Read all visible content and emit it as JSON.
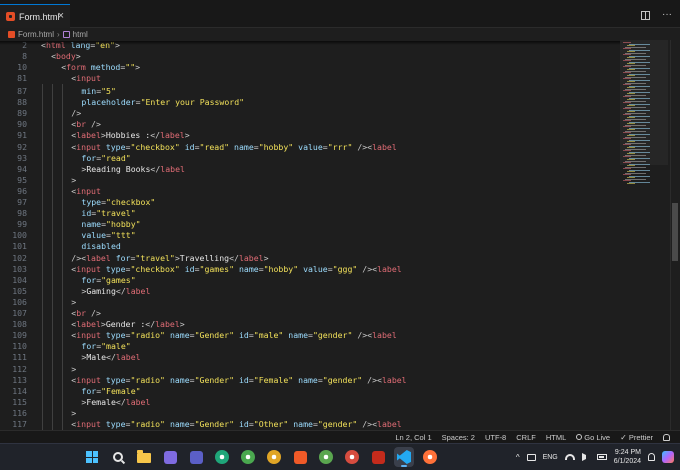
{
  "tab": {
    "label": "Form.html",
    "close": "×"
  },
  "breadcrumb": {
    "file": "Form.html",
    "separator": "›",
    "element": "html"
  },
  "editor": {
    "sticky_lines": [
      {
        "num": "2",
        "indent": 0,
        "tokens": [
          [
            "punc",
            "<"
          ],
          [
            "tag",
            "html"
          ],
          [
            "text",
            " "
          ],
          [
            "attr",
            "lang"
          ],
          [
            "eq",
            "="
          ],
          [
            "str",
            "\"en\""
          ],
          [
            "punc",
            ">"
          ]
        ]
      },
      {
        "num": "8",
        "indent": 1,
        "tokens": [
          [
            "punc",
            "<"
          ],
          [
            "tag",
            "body"
          ],
          [
            "punc",
            ">"
          ]
        ]
      },
      {
        "num": "10",
        "indent": 2,
        "tokens": [
          [
            "punc",
            "<"
          ],
          [
            "tag",
            "form"
          ],
          [
            "text",
            " "
          ],
          [
            "attr",
            "method"
          ],
          [
            "eq",
            "="
          ],
          [
            "str",
            "\"\""
          ],
          [
            "punc",
            ">"
          ]
        ]
      },
      {
        "num": "81",
        "indent": 3,
        "tokens": [
          [
            "punc",
            "<"
          ],
          [
            "tag",
            "input"
          ]
        ]
      }
    ],
    "lines": [
      {
        "num": "87",
        "indent": 4,
        "tokens": [
          [
            "attr",
            "min"
          ],
          [
            "eq",
            "="
          ],
          [
            "str",
            "\"5\""
          ]
        ]
      },
      {
        "num": "88",
        "indent": 4,
        "tokens": [
          [
            "attr",
            "placeholder"
          ],
          [
            "eq",
            "="
          ],
          [
            "str",
            "\"Enter your Password\""
          ]
        ]
      },
      {
        "num": "89",
        "indent": 3,
        "tokens": [
          [
            "punc",
            "/>"
          ]
        ]
      },
      {
        "num": "90",
        "indent": 3,
        "tokens": [
          [
            "punc",
            "<"
          ],
          [
            "tag",
            "br"
          ],
          [
            "text",
            " "
          ],
          [
            "punc",
            "/>"
          ]
        ]
      },
      {
        "num": "91",
        "indent": 3,
        "tokens": [
          [
            "punc",
            "<"
          ],
          [
            "tag",
            "label"
          ],
          [
            "punc",
            ">"
          ],
          [
            "text",
            "Hobbies :"
          ],
          [
            "punc",
            "</"
          ],
          [
            "tag",
            "label"
          ],
          [
            "punc",
            ">"
          ]
        ]
      },
      {
        "num": "92",
        "indent": 3,
        "tokens": [
          [
            "punc",
            "<"
          ],
          [
            "tag",
            "input"
          ],
          [
            "text",
            " "
          ],
          [
            "attr",
            "type"
          ],
          [
            "eq",
            "="
          ],
          [
            "str",
            "\"checkbox\""
          ],
          [
            "text",
            " "
          ],
          [
            "attr",
            "id"
          ],
          [
            "eq",
            "="
          ],
          [
            "str",
            "\"read\""
          ],
          [
            "text",
            " "
          ],
          [
            "attr",
            "name"
          ],
          [
            "eq",
            "="
          ],
          [
            "str",
            "\"hobby\""
          ],
          [
            "text",
            " "
          ],
          [
            "attr",
            "value"
          ],
          [
            "eq",
            "="
          ],
          [
            "str",
            "\"rrr\""
          ],
          [
            "text",
            " "
          ],
          [
            "punc",
            "/><"
          ],
          [
            "tag",
            "label"
          ]
        ]
      },
      {
        "num": "93",
        "indent": 4,
        "tokens": [
          [
            "attr",
            "for"
          ],
          [
            "eq",
            "="
          ],
          [
            "str",
            "\"read\""
          ]
        ]
      },
      {
        "num": "94",
        "indent": 4,
        "tokens": [
          [
            "punc",
            ">"
          ],
          [
            "text",
            "Reading Books"
          ],
          [
            "punc",
            "</"
          ],
          [
            "tag",
            "label"
          ]
        ]
      },
      {
        "num": "95",
        "indent": 3,
        "tokens": [
          [
            "punc",
            ">"
          ]
        ]
      },
      {
        "num": "96",
        "indent": 3,
        "tokens": [
          [
            "punc",
            "<"
          ],
          [
            "tag",
            "input"
          ]
        ]
      },
      {
        "num": "97",
        "indent": 4,
        "tokens": [
          [
            "attr",
            "type"
          ],
          [
            "eq",
            "="
          ],
          [
            "str",
            "\"checkbox\""
          ]
        ]
      },
      {
        "num": "98",
        "indent": 4,
        "tokens": [
          [
            "attr",
            "id"
          ],
          [
            "eq",
            "="
          ],
          [
            "str",
            "\"travel\""
          ]
        ]
      },
      {
        "num": "99",
        "indent": 4,
        "tokens": [
          [
            "attr",
            "name"
          ],
          [
            "eq",
            "="
          ],
          [
            "str",
            "\"hobby\""
          ]
        ]
      },
      {
        "num": "100",
        "indent": 4,
        "tokens": [
          [
            "attr",
            "value"
          ],
          [
            "eq",
            "="
          ],
          [
            "str",
            "\"ttt\""
          ]
        ]
      },
      {
        "num": "101",
        "indent": 4,
        "tokens": [
          [
            "attr",
            "disabled"
          ]
        ]
      },
      {
        "num": "102",
        "indent": 3,
        "tokens": [
          [
            "punc",
            "/><"
          ],
          [
            "tag",
            "label"
          ],
          [
            "text",
            " "
          ],
          [
            "attr",
            "for"
          ],
          [
            "eq",
            "="
          ],
          [
            "str",
            "\"travel\""
          ],
          [
            "punc",
            ">"
          ],
          [
            "text",
            "Travelling"
          ],
          [
            "punc",
            "</"
          ],
          [
            "tag",
            "label"
          ],
          [
            "punc",
            ">"
          ]
        ]
      },
      {
        "num": "103",
        "indent": 3,
        "tokens": [
          [
            "punc",
            "<"
          ],
          [
            "tag",
            "input"
          ],
          [
            "text",
            " "
          ],
          [
            "attr",
            "type"
          ],
          [
            "eq",
            "="
          ],
          [
            "str",
            "\"checkbox\""
          ],
          [
            "text",
            " "
          ],
          [
            "attr",
            "id"
          ],
          [
            "eq",
            "="
          ],
          [
            "str",
            "\"games\""
          ],
          [
            "text",
            " "
          ],
          [
            "attr",
            "name"
          ],
          [
            "eq",
            "="
          ],
          [
            "str",
            "\"hobby\""
          ],
          [
            "text",
            " "
          ],
          [
            "attr",
            "value"
          ],
          [
            "eq",
            "="
          ],
          [
            "str",
            "\"ggg\""
          ],
          [
            "text",
            " "
          ],
          [
            "punc",
            "/><"
          ],
          [
            "tag",
            "label"
          ]
        ]
      },
      {
        "num": "104",
        "indent": 4,
        "tokens": [
          [
            "attr",
            "for"
          ],
          [
            "eq",
            "="
          ],
          [
            "str",
            "\"games\""
          ]
        ]
      },
      {
        "num": "105",
        "indent": 4,
        "tokens": [
          [
            "punc",
            ">"
          ],
          [
            "text",
            "Gaming"
          ],
          [
            "punc",
            "</"
          ],
          [
            "tag",
            "label"
          ]
        ]
      },
      {
        "num": "106",
        "indent": 3,
        "tokens": [
          [
            "punc",
            ">"
          ]
        ]
      },
      {
        "num": "107",
        "indent": 3,
        "tokens": [
          [
            "punc",
            "<"
          ],
          [
            "tag",
            "br"
          ],
          [
            "text",
            " "
          ],
          [
            "punc",
            "/>"
          ]
        ]
      },
      {
        "num": "108",
        "indent": 3,
        "tokens": [
          [
            "punc",
            "<"
          ],
          [
            "tag",
            "label"
          ],
          [
            "punc",
            ">"
          ],
          [
            "text",
            "Gender :"
          ],
          [
            "punc",
            "</"
          ],
          [
            "tag",
            "label"
          ],
          [
            "punc",
            ">"
          ]
        ]
      },
      {
        "num": "109",
        "indent": 3,
        "tokens": [
          [
            "punc",
            "<"
          ],
          [
            "tag",
            "input"
          ],
          [
            "text",
            " "
          ],
          [
            "attr",
            "type"
          ],
          [
            "eq",
            "="
          ],
          [
            "str",
            "\"radio\""
          ],
          [
            "text",
            " "
          ],
          [
            "attr",
            "name"
          ],
          [
            "eq",
            "="
          ],
          [
            "str",
            "\"Gender\""
          ],
          [
            "text",
            " "
          ],
          [
            "attr",
            "id"
          ],
          [
            "eq",
            "="
          ],
          [
            "str",
            "\"male\""
          ],
          [
            "text",
            " "
          ],
          [
            "attr",
            "name"
          ],
          [
            "eq",
            "="
          ],
          [
            "str",
            "\"gender\""
          ],
          [
            "text",
            " "
          ],
          [
            "punc",
            "/><"
          ],
          [
            "tag",
            "label"
          ]
        ]
      },
      {
        "num": "110",
        "indent": 4,
        "tokens": [
          [
            "attr",
            "for"
          ],
          [
            "eq",
            "="
          ],
          [
            "str",
            "\"male\""
          ]
        ]
      },
      {
        "num": "111",
        "indent": 4,
        "tokens": [
          [
            "punc",
            ">"
          ],
          [
            "text",
            "Male"
          ],
          [
            "punc",
            "</"
          ],
          [
            "tag",
            "label"
          ]
        ]
      },
      {
        "num": "112",
        "indent": 3,
        "tokens": [
          [
            "punc",
            ">"
          ]
        ]
      },
      {
        "num": "113",
        "indent": 3,
        "tokens": [
          [
            "punc",
            "<"
          ],
          [
            "tag",
            "input"
          ],
          [
            "text",
            " "
          ],
          [
            "attr",
            "type"
          ],
          [
            "eq",
            "="
          ],
          [
            "str",
            "\"radio\""
          ],
          [
            "text",
            " "
          ],
          [
            "attr",
            "name"
          ],
          [
            "eq",
            "="
          ],
          [
            "str",
            "\"Gender\""
          ],
          [
            "text",
            " "
          ],
          [
            "attr",
            "id"
          ],
          [
            "eq",
            "="
          ],
          [
            "str",
            "\"Female\""
          ],
          [
            "text",
            " "
          ],
          [
            "attr",
            "name"
          ],
          [
            "eq",
            "="
          ],
          [
            "str",
            "\"gender\""
          ],
          [
            "text",
            " "
          ],
          [
            "punc",
            "/><"
          ],
          [
            "tag",
            "label"
          ]
        ]
      },
      {
        "num": "114",
        "indent": 4,
        "tokens": [
          [
            "attr",
            "for"
          ],
          [
            "eq",
            "="
          ],
          [
            "str",
            "\"Female\""
          ]
        ]
      },
      {
        "num": "115",
        "indent": 4,
        "tokens": [
          [
            "punc",
            ">"
          ],
          [
            "text",
            "Female"
          ],
          [
            "punc",
            "</"
          ],
          [
            "tag",
            "label"
          ]
        ]
      },
      {
        "num": "116",
        "indent": 3,
        "tokens": [
          [
            "punc",
            ">"
          ]
        ]
      },
      {
        "num": "117",
        "indent": 3,
        "tokens": [
          [
            "punc",
            "<"
          ],
          [
            "tag",
            "input"
          ],
          [
            "text",
            " "
          ],
          [
            "attr",
            "type"
          ],
          [
            "eq",
            "="
          ],
          [
            "str",
            "\"radio\""
          ],
          [
            "text",
            " "
          ],
          [
            "attr",
            "name"
          ],
          [
            "eq",
            "="
          ],
          [
            "str",
            "\"Gender\""
          ],
          [
            "text",
            " "
          ],
          [
            "attr",
            "id"
          ],
          [
            "eq",
            "="
          ],
          [
            "str",
            "\"Other\""
          ],
          [
            "text",
            " "
          ],
          [
            "attr",
            "name"
          ],
          [
            "eq",
            "="
          ],
          [
            "str",
            "\"gender\""
          ],
          [
            "text",
            " "
          ],
          [
            "punc",
            "/><"
          ],
          [
            "tag",
            "label"
          ]
        ]
      }
    ]
  },
  "statusbar": {
    "position": "Ln 2, Col 1",
    "spaces": "Spaces: 2",
    "encoding": "UTF-8",
    "eol": "CRLF",
    "language": "HTML",
    "golive": "Go Live",
    "prettier": "Prettier"
  },
  "taskbar": {
    "apps": [
      {
        "name": "start-button",
        "icon": "windows-icon"
      },
      {
        "name": "taskbar-search",
        "icon": "search-icon"
      },
      {
        "name": "taskbar-file-explorer",
        "icon": "folder-icon",
        "color": "#f7c64a"
      },
      {
        "name": "taskbar-app-purple",
        "icon": "purple-app-icon",
        "color": "#7f6be0"
      },
      {
        "name": "taskbar-app-indigo",
        "icon": "indigo-app-icon",
        "color": "#5b5fc7"
      },
      {
        "name": "taskbar-edge",
        "icon": "edge-icon",
        "color": "#1fa67a"
      },
      {
        "name": "taskbar-chrome-1",
        "icon": "chrome-icon",
        "color": "#4aa84f"
      },
      {
        "name": "taskbar-chrome-2",
        "icon": "chrome-icon",
        "color": "#e0a526"
      },
      {
        "name": "taskbar-brave",
        "icon": "brave-icon",
        "color": "#f05a28"
      },
      {
        "name": "taskbar-chrome-3",
        "icon": "chrome-icon",
        "color": "#5aa64f"
      },
      {
        "name": "taskbar-chrome-4",
        "icon": "chrome-icon",
        "color": "#d64c3f"
      },
      {
        "name": "taskbar-app-red",
        "icon": "red-app-icon",
        "color": "#c42b1c"
      },
      {
        "name": "taskbar-vscode",
        "icon": "vscode-icon",
        "color": "#23a9f2",
        "active": true
      },
      {
        "name": "taskbar-firefox",
        "icon": "firefox-icon",
        "color": "#ff7139"
      }
    ],
    "tray": {
      "chevron": "^",
      "language": "ENG",
      "time": "9:24 PM",
      "date": "6/1/2024"
    }
  },
  "colors": {
    "tag": "#e06c75",
    "attr": "#9cdcfe",
    "string": "#f1e05a",
    "accent": "#0078d4"
  }
}
